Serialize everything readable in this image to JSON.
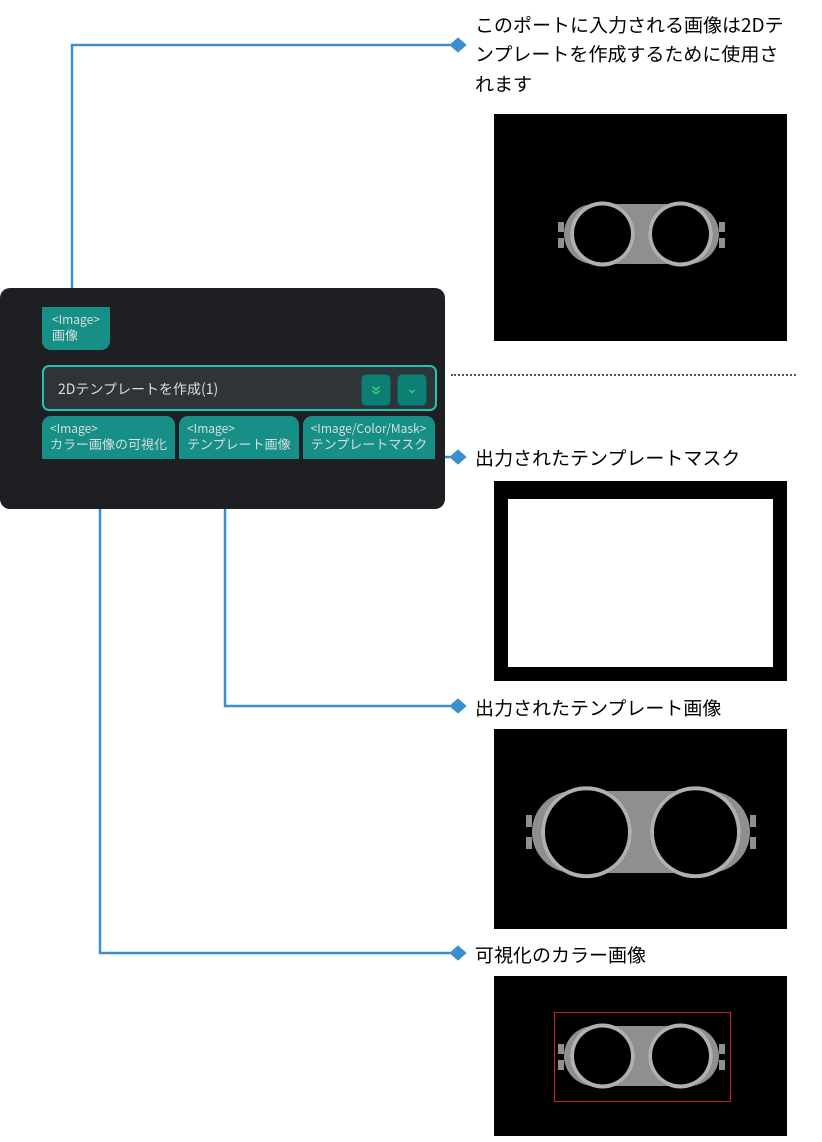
{
  "node": {
    "input_port": {
      "type": "<Image>",
      "label": "画像"
    },
    "title": "2Dテンプレートを作成(1)",
    "output_ports": [
      {
        "type": "<Image>",
        "label": "カラー画像の可視化"
      },
      {
        "type": "<Image>",
        "label": "テンプレート画像"
      },
      {
        "type": "<Image/Color/Mask>",
        "label": "テンプレートマスク"
      }
    ],
    "button_expand_name": "expand-button",
    "button_run_name": "run-button"
  },
  "captions": {
    "input": "このポートに入力される画像は2Dテンプレートを作成するために使用されます",
    "mask": "出力されたテンプレートマスク",
    "template_image": "出力されたテンプレート画像",
    "color_image": "可視化のカラー画像"
  }
}
